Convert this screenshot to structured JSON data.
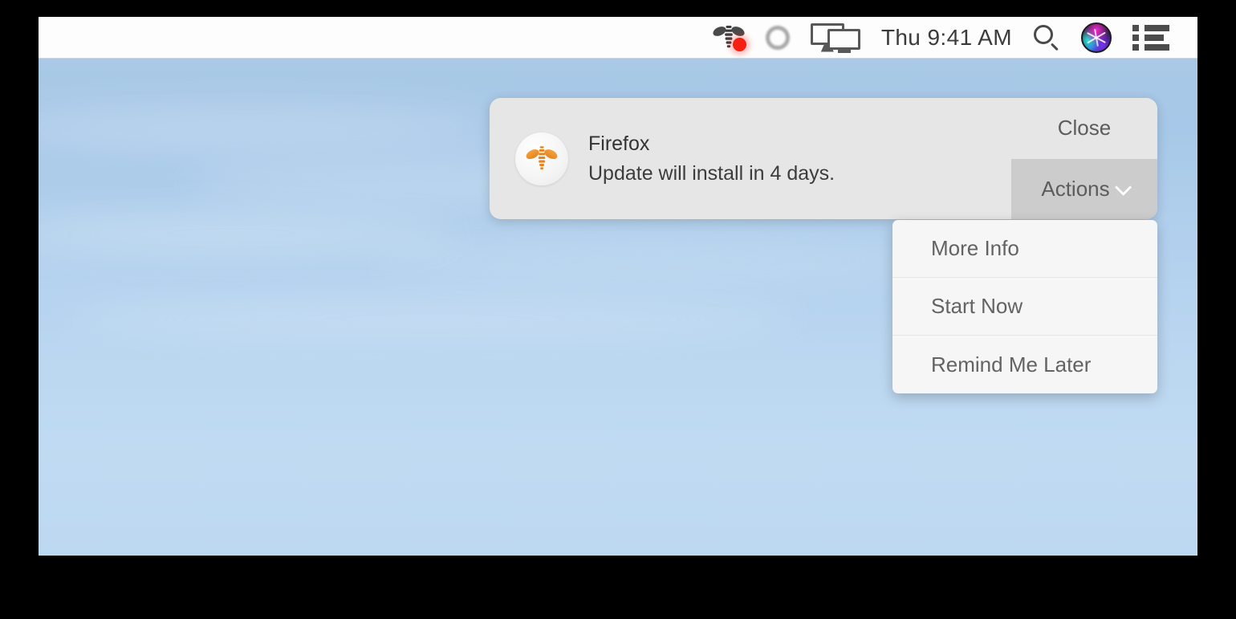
{
  "menubar": {
    "status_items": [
      {
        "name": "bee-status-icon",
        "icon": "bee-icon",
        "badge": "unread-dot",
        "badge_color": "#f51f12"
      },
      {
        "name": "sync-ring-icon",
        "icon": "ring-icon"
      },
      {
        "name": "display-mirroring-icon",
        "icon": "displays-icon"
      }
    ],
    "clock": "Thu 9:41 AM",
    "search_icon": "search-icon",
    "siri_icon": "siri-icon",
    "notification_center_icon": "list-icon"
  },
  "notification": {
    "app_icon": "bee-app-icon",
    "title": "Firefox",
    "message": "Update will install in 4 days.",
    "close_label": "Close",
    "actions_label": "Actions",
    "actions_chevron": "chevron-down-icon",
    "background_color": "#e6e6e6",
    "actions_active_color": "#cccccc"
  },
  "actions_menu": {
    "items": [
      {
        "label": "More Info"
      },
      {
        "label": "Start Now"
      },
      {
        "label": "Remind Me Later"
      }
    ]
  },
  "desktop": {
    "wallpaper": "blue-sky-with-clouds"
  }
}
